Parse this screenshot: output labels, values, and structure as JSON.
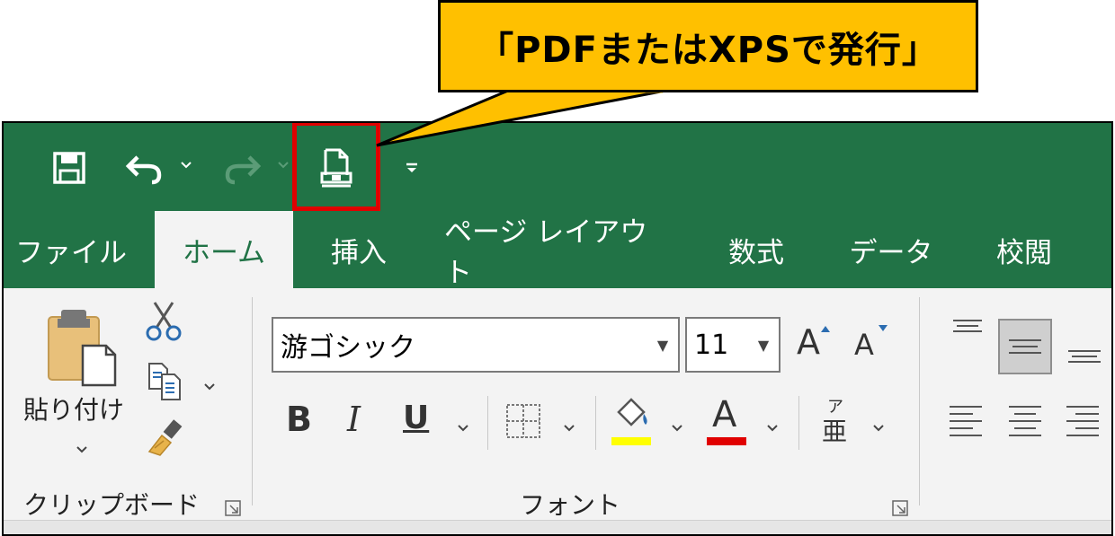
{
  "callout": {
    "text": "「PDFまたはXPSで発行」"
  },
  "qat": {
    "save_icon": "save-icon",
    "undo_icon": "undo-icon",
    "redo_icon": "redo-icon",
    "publish_icon": "publish-pdf-xps-icon",
    "customize_icon": "customize-qat-icon"
  },
  "tabs": [
    {
      "label": "ファイル",
      "active": false
    },
    {
      "label": "ホーム",
      "active": true
    },
    {
      "label": "挿入",
      "active": false
    },
    {
      "label": "ページ レイアウト",
      "active": false
    },
    {
      "label": "数式",
      "active": false
    },
    {
      "label": "データ",
      "active": false
    },
    {
      "label": "校閲",
      "active": false
    }
  ],
  "clipboard": {
    "paste_label": "貼り付け",
    "group_label": "クリップボード"
  },
  "font": {
    "font_name": "游ゴシック",
    "font_size": "11",
    "bold": "B",
    "italic": "I",
    "underline": "U",
    "grow_font": "A",
    "shrink_font": "A",
    "font_color_letter": "A",
    "phonetic": "ア",
    "phonetic_base": "亜",
    "group_label": "フォント",
    "fill_color": "#ffff00",
    "font_color": "#e00000"
  },
  "colors": {
    "excel_green": "#217346",
    "callout_fill": "#ffc000",
    "highlight": "#e00000"
  }
}
